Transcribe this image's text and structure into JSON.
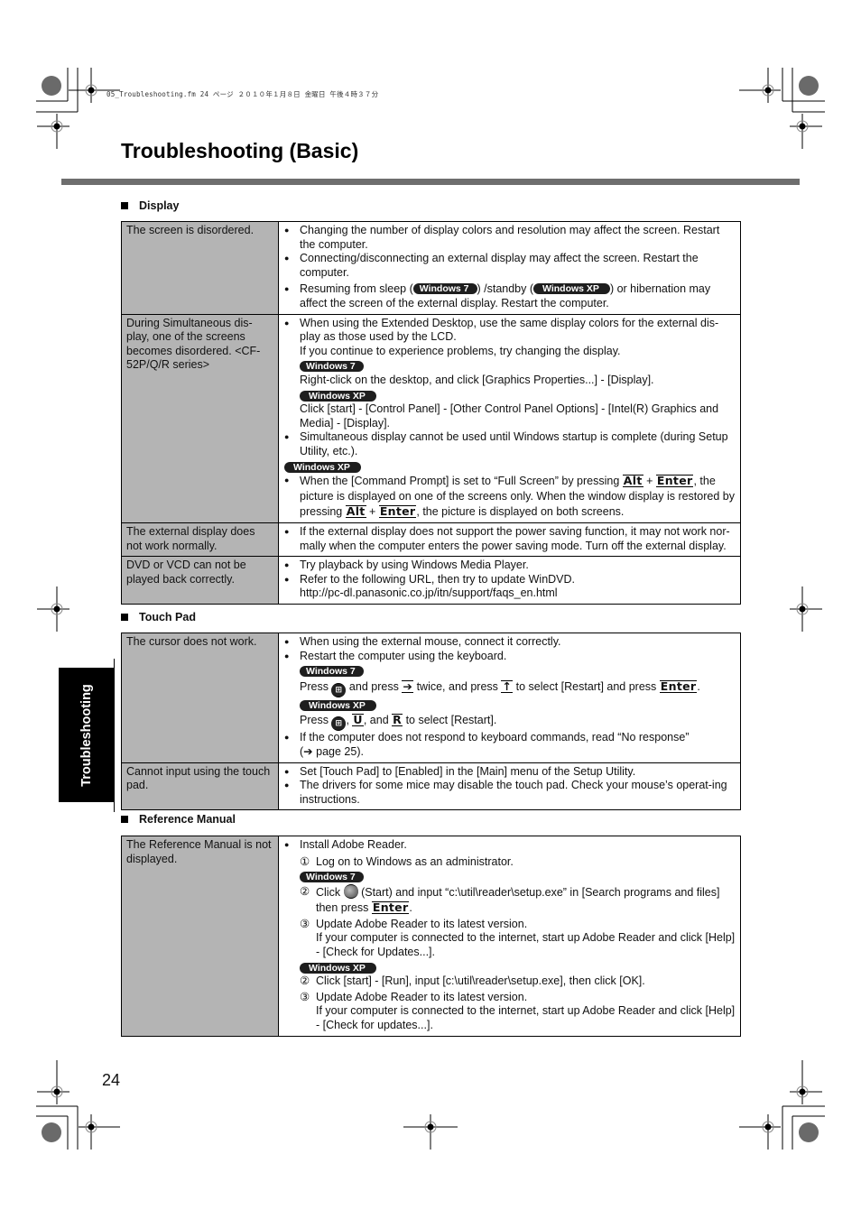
{
  "header_meta": "05_Troubleshooting.fm  24 ページ  ２０１０年１月８日  金曜日  午後４時３７分",
  "page_title": "Troubleshooting (Basic)",
  "side_tab_label": "Troubleshooting",
  "page_number": "24",
  "badges": {
    "win7": "Windows 7",
    "winxp": "Windows XP"
  },
  "keys": {
    "alt": "Alt",
    "enter": "Enter",
    "u": "U",
    "r": "R",
    "right_arrow": "➔",
    "up_arrow": "🡅",
    "arrow_ref": "➔"
  },
  "sections": {
    "display": {
      "heading": "Display",
      "rows": [
        {
          "problem": "The screen is disordered.",
          "s1": "Changing the number of display colors and resolution may affect the screen. Restart the computer.",
          "s2": "Connecting/disconnecting an external display may affect the screen. Restart the computer.",
          "s3a": "Resuming from sleep (",
          "s3b": ") /standby (",
          "s3c": ") or hibernation may affect the screen of the external display. Restart the computer."
        },
        {
          "problem": "During Simultaneous dis-play, one of the screens becomes disordered. <CF-52P/Q/R series>",
          "s1a": "When using the Extended Desktop, use the same display colors for the external dis-play as those used by the LCD.",
          "s1b": "If you continue to experience problems, try changing the display.",
          "s1_win7": "Right-click on the desktop, and click [Graphics Properties...] - [Display].",
          "s1_winxp": "Click [start] - [Control Panel] - [Other Control Panel Options] - [Intel(R) Graphics and Media] - [Display].",
          "s2": "Simultaneous display cannot be used until Windows startup is complete (during Setup Utility, etc.).",
          "s3a": "When the [Command Prompt] is set to “Full Screen” by pressing",
          "s3b": ", the picture is displayed on one of the screens only. When the window display is restored by pressing",
          "s3c": ", the picture is displayed on both screens."
        },
        {
          "problem": "The external display does not work normally.",
          "s1": "If the external display does not support the power saving function, it may not work nor-mally when the computer enters the power saving mode. Turn off the external display."
        },
        {
          "problem": "DVD or VCD can not be played back correctly.",
          "s1": "Try playback by using Windows Media Player.",
          "s2": "Refer to the following URL, then try to update WinDVD.",
          "url": "http://pc-dl.panasonic.co.jp/itn/support/faqs_en.html"
        }
      ]
    },
    "touchpad": {
      "heading": "Touch Pad",
      "rows": [
        {
          "problem": "The cursor does not work.",
          "s1": "When using the external mouse, connect it correctly.",
          "s2": "Restart the computer using the keyboard.",
          "w7a": "Press",
          "w7b": "and press",
          "w7c": "twice, and press",
          "w7d": "to select [Restart] and press",
          "xpa": "Press",
          "xpb": ",",
          "xpc": ", and",
          "xpd": "to select [Restart].",
          "s3": "If the computer does not respond to keyboard commands, read “No response”",
          "s3_ref": "page 25)."
        },
        {
          "problem": "Cannot input using the touch pad.",
          "s1": "Set [Touch Pad] to [Enabled] in the [Main] menu of the Setup Utility.",
          "s2": "The drivers for some mice may disable the touch pad. Check your mouse’s operat-ing instructions."
        }
      ]
    },
    "reference": {
      "heading": "Reference Manual",
      "rows": [
        {
          "problem": "The Reference Manual is not displayed.",
          "s1": "Install Adobe Reader.",
          "step1": "Log on to Windows as an administrator.",
          "w7_step2a": "Click",
          "w7_step2b": "(Start) and input “c:\\util\\reader\\setup.exe” in [Search programs and files] then press",
          "w7_step3": "Update Adobe Reader to its latest version.",
          "w7_step3b": "If your computer is connected to the internet, start up Adobe Reader and click [Help] - [Check for Updates...].",
          "xp_step2": "Click [start] - [Run], input [c:\\util\\reader\\setup.exe], then click [OK].",
          "xp_step3": "Update Adobe Reader to its latest version.",
          "xp_step3b": "If your computer is connected to the internet, start up Adobe Reader and click [Help] - [Check for updates...]."
        }
      ]
    }
  },
  "step_markers": [
    "①",
    "②",
    "③"
  ]
}
